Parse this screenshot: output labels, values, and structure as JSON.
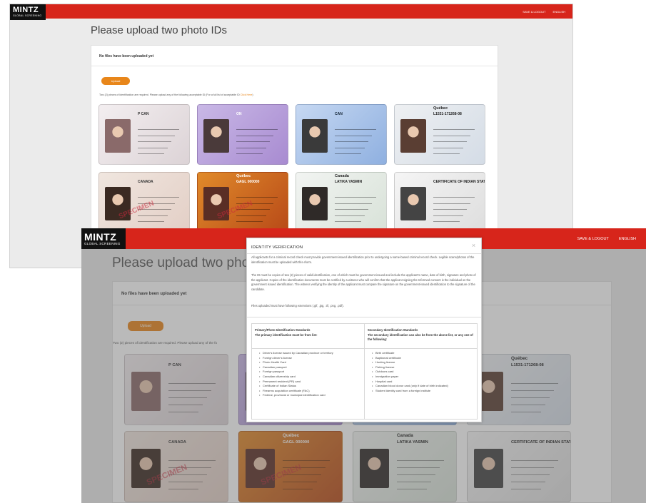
{
  "app": {
    "logo": "MINTZ",
    "logo_sub": "GLOBAL SCREENING",
    "nav": [
      "SAVE & LOGOUT",
      "ENGLISH"
    ]
  },
  "page": {
    "title": "Please upload two photo IDs",
    "no_files": "No files have been uploaded yet",
    "upload_label": "Upload",
    "instructions_prefix": "Two (2) pieces of identification are required. Please upload any of the following acceptable ID (For a full list of acceptable ID ",
    "instructions_link": "Click Here",
    "instructions_suffix": ")",
    "instructions_short": "Two (2) pieces of identification are required. Please upload any of the fo"
  },
  "id_cards": [
    {
      "kind": "passport",
      "text": "P   CAN"
    },
    {
      "kind": "photo-card",
      "text": "ON"
    },
    {
      "kind": "drivers-licence",
      "text": "CAN"
    },
    {
      "kind": "permis-de-conduire",
      "text": "L1531-171268-08",
      "brand": "Québec"
    },
    {
      "kind": "passport-page",
      "text": "CANADA",
      "stamp": "SPECIMEN"
    },
    {
      "kind": "quebec-health-card",
      "text": "GAGL 000000",
      "stamp": "SPECIMEN",
      "brand": "Québec"
    },
    {
      "kind": "pr-card",
      "text": "LATIKA YASMIN",
      "brand": "Canada"
    },
    {
      "kind": "status-card",
      "text": "CERTIFICATE OF INDIAN STATUS"
    }
  ],
  "modal": {
    "title": "IDENTITY VERIFICATION",
    "close_glyph": "×",
    "para1": "All applicants for a criminal record check must provide government-issued identification prior to undergoing a name-based criminal record check. Legible scans/photos of the identification must be uploaded with this eform.",
    "para2": "The ID must be copies of two (2) pieces of valid identification, one of which must be government-issued and include the applicant's name, date of birth, signature and photo of the applicant. Copies of the identification documents must be certified by a witness who will confirm that the applicant signing the Informed consent is the individual on the government issued identification. The witness verifying the identity of the applicant must compare the signature on the government-issued identification to the signature of the candidate.",
    "para3": "Files uploaded must have following extensions (.gif, .jpg, .tif, .png, .pdf).",
    "primary_title": "Primary/Photo Identification Standards",
    "primary_sub": "The primary identification must be from list:",
    "primary_items": [
      "Driver's license issued by Canadian province or territory",
      "Foreign driver's license",
      "Photo Health Card",
      "Canadian passport",
      "Foreign passport",
      "Canadian citizenship card",
      "Permanent resident (PR) card",
      "Certificate of Indian Status",
      "Firearms acquisition certificate (FAC)",
      "Federal, provincial or municipal identification card"
    ],
    "secondary_title": "Secondary Identification Standards",
    "secondary_sub": "The secondary identification can also be from the above list, or any one of the following:",
    "secondary_items": [
      "Birth certificate",
      "Baptismal certificate",
      "Hunting license",
      "Fishing license",
      "Outdoors card",
      "Immigration paper",
      "Hospital card",
      "Canadian blood donor card (only if date of birth indicated)",
      "Student identity card from a foreign institute"
    ]
  },
  "colors": {
    "brand_red": "#d7251b",
    "accent_orange": "#e8861a",
    "logo_bg": "#111111"
  }
}
